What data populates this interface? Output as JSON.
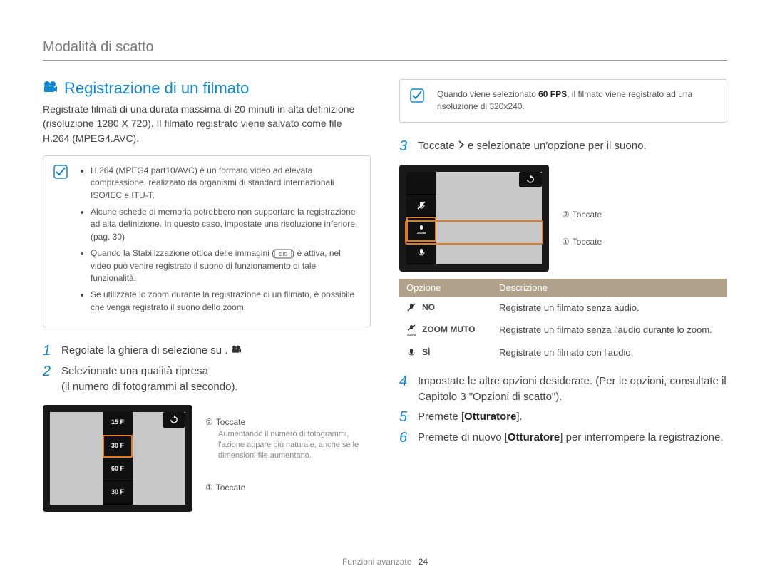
{
  "breadcrumb": "Modalità di scatto",
  "heading": "Registrazione di un filmato",
  "intro": "Registrate filmati di una durata massima di 20 minuti in alta definizione (risoluzione 1280 X 720). Il filmato registrato viene salvato come file H.264 (MPEG4.AVC).",
  "notes_left": [
    "H.264 (MPEG4 part10/AVC) è un formato video ad elevata compressione, realizzato da organismi di standard internazionali ISO/IEC e ITU-T.",
    "Alcune schede di memoria potrebbero non supportare la registrazione ad alta definizione. In questo caso, impostate una risoluzione inferiore. (pag. 30)",
    "Quando la Stabilizzazione ottica delle immagini () è attiva, nel video può venire registrato il suono di funzionamento di tale funzionalità.",
    "Se utilizzate lo zoom durante la registrazione di un filmato, è possibile che venga registrato il suono dello zoom."
  ],
  "ois_note_prefix": "Quando la Stabilizzazione ottica delle immagini (",
  "ois_note_suffix": ") è attiva, nel video può venire registrato il suono di funzionamento di tale funzionalità.",
  "steps": {
    "s1": "Regolate la ghiera di selezione su .",
    "s2": "Selezionate una qualità ripresa (il numero di fotogrammi al secondo).",
    "s2_line1": "Selezionate una qualità ripresa",
    "s2_line2": "(il numero di fotogrammi al secondo).",
    "s3_prefix": "Toccate ",
    "s3_suffix": " e selezionate un'opzione per il suono.",
    "s4": "Impostate le altre opzioni desiderate. (Per le opzioni, consultate il Capitolo 3 \"Opzioni di scatto\").",
    "s5_prefix": "Premete [",
    "s5_bold": "Otturatore",
    "s5_suffix": "].",
    "s6_prefix": "Premete di nuovo [",
    "s6_bold": "Otturatore",
    "s6_suffix": "] per interrompere la registrazione."
  },
  "callouts_left": {
    "c2": "Toccate",
    "c2_desc": "Aumentando il numero di fotogrammi, l'azione appare più naturale, anche se le dimensioni file aumentano.",
    "c1": "Toccate"
  },
  "speed_strip": [
    "15 F",
    "30 F",
    "60 F",
    "30 F"
  ],
  "note_right_prefix": "Quando viene selezionato ",
  "note_right_bold": "60 FPS",
  "note_right_suffix": ", il filmato viene registrato ad una risoluzione di 320x240.",
  "callouts_right": {
    "c2": "Toccate",
    "c1": "Toccate"
  },
  "table": {
    "headers": [
      "Opzione",
      "Descrizione"
    ],
    "rows": [
      {
        "label": "NO",
        "desc": "Registrate un filmato senza audio.",
        "icon": "mic-mute"
      },
      {
        "label": "ZOOM MUTO",
        "desc": "Registrate un filmato senza l'audio durante lo zoom.",
        "icon": "mic-zoom-mute"
      },
      {
        "label": "SÌ",
        "desc": "Registrate un filmato con l'audio.",
        "icon": "mic-on"
      }
    ]
  },
  "footer_section": "Funzioni avanzate",
  "footer_page": "24",
  "glyphs": {
    "circled1": "①",
    "circled2": "②"
  }
}
